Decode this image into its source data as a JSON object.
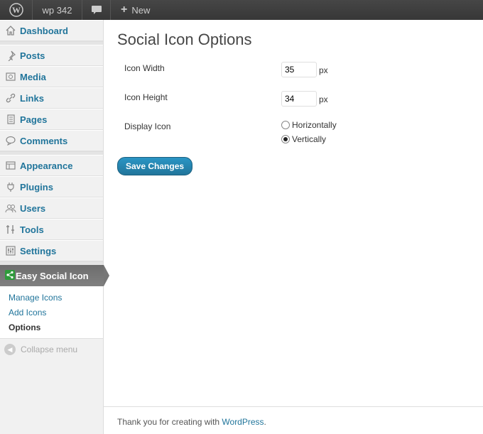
{
  "admin_bar": {
    "site_name": "wp 342",
    "new_label": "New",
    "wp_logo_icon": "wordpress-logo-icon",
    "comment_icon": "speech-bubble-icon"
  },
  "sidebar": {
    "items": [
      {
        "label": "Dashboard",
        "icon": "home-icon"
      },
      {
        "label": "Posts",
        "icon": "pushpin-icon"
      },
      {
        "label": "Media",
        "icon": "media-icon"
      },
      {
        "label": "Links",
        "icon": "link-icon"
      },
      {
        "label": "Pages",
        "icon": "pages-icon"
      },
      {
        "label": "Comments",
        "icon": "comments-icon"
      },
      {
        "label": "Appearance",
        "icon": "appearance-icon"
      },
      {
        "label": "Plugins",
        "icon": "plug-icon"
      },
      {
        "label": "Users",
        "icon": "users-icon"
      },
      {
        "label": "Tools",
        "icon": "tools-icon"
      },
      {
        "label": "Settings",
        "icon": "settings-icon"
      }
    ],
    "current": {
      "label": "Easy Social Icon",
      "icon": "share-icon"
    },
    "submenu": [
      {
        "label": "Manage Icons"
      },
      {
        "label": "Add Icons"
      },
      {
        "label": "Options"
      }
    ],
    "collapse_label": "Collapse menu"
  },
  "main": {
    "title": "Social Icon Options",
    "icon_width": {
      "label": "Icon Width",
      "value": "35",
      "unit": "px"
    },
    "icon_height": {
      "label": "Icon Height",
      "value": "34",
      "unit": "px"
    },
    "display_icon": {
      "label": "Display Icon",
      "options": [
        "Horizontally",
        "Vertically"
      ],
      "selected": "Vertically"
    },
    "save_label": "Save Changes"
  },
  "footer": {
    "text": "Thank you for creating with ",
    "link": "WordPress",
    "suffix": "."
  },
  "colors": {
    "link": "#21759b",
    "admin_bar": "#464646",
    "button": "#21759b"
  }
}
